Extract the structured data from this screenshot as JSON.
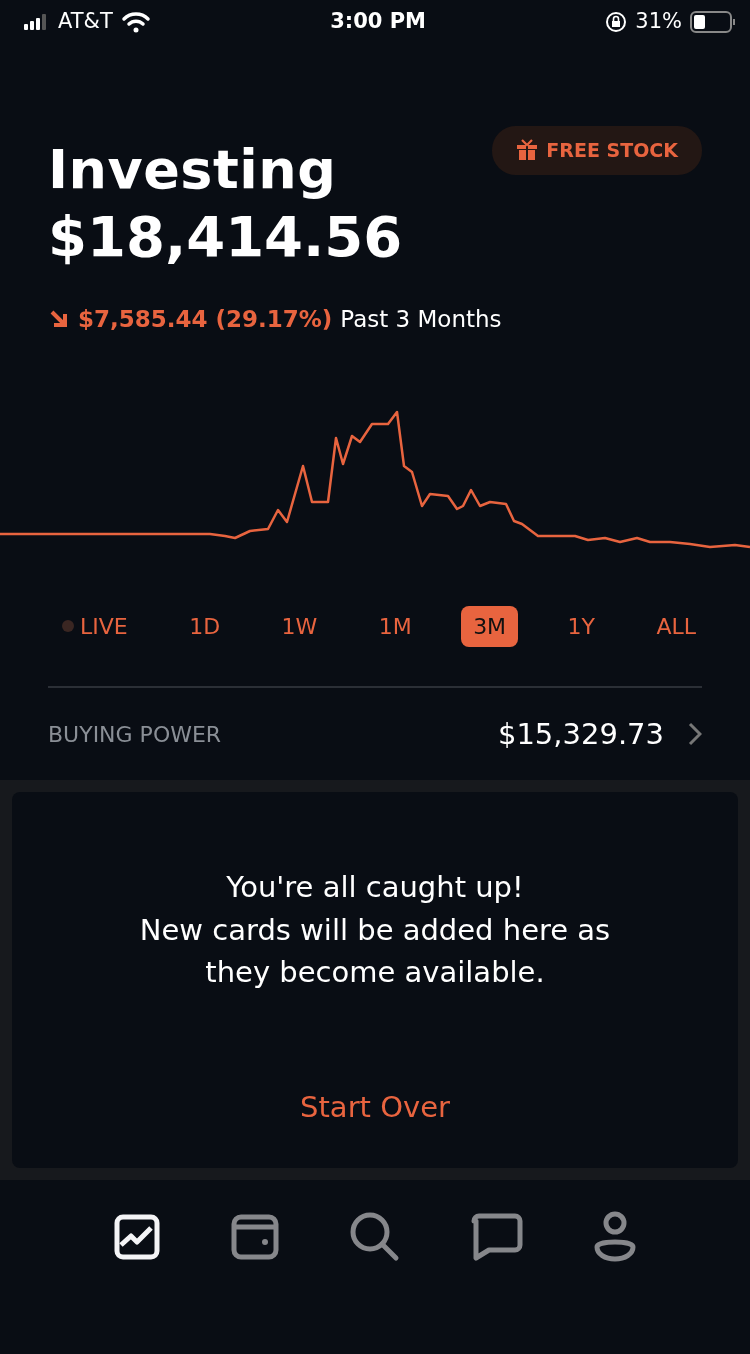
{
  "status_bar": {
    "carrier": "AT&T",
    "time": "3:00 PM",
    "battery": "31%"
  },
  "header": {
    "title": "Investing",
    "balance": "$18,414.56",
    "badge": "FREE STOCK"
  },
  "change": {
    "falling": true,
    "amount": "$7,585.44 (29.17%)",
    "period": "Past 3 Months"
  },
  "ranges": [
    {
      "label": "LIVE",
      "selected": false,
      "live": true
    },
    {
      "label": "1D",
      "selected": false
    },
    {
      "label": "1W",
      "selected": false
    },
    {
      "label": "1M",
      "selected": false
    },
    {
      "label": "3M",
      "selected": true
    },
    {
      "label": "1Y",
      "selected": false
    },
    {
      "label": "ALL",
      "selected": false
    }
  ],
  "buying_power": {
    "label": "BUYING POWER",
    "value": "$15,329.73"
  },
  "card": {
    "message": "You're all caught up!\nNew cards will be added here as they become available.",
    "action": "Start Over"
  },
  "tab_bar": [
    {
      "kind": "chart",
      "selected": true
    },
    {
      "kind": "wallet",
      "selected": false
    },
    {
      "kind": "search",
      "selected": false
    },
    {
      "kind": "chat",
      "selected": false
    },
    {
      "kind": "account",
      "selected": false
    }
  ]
}
